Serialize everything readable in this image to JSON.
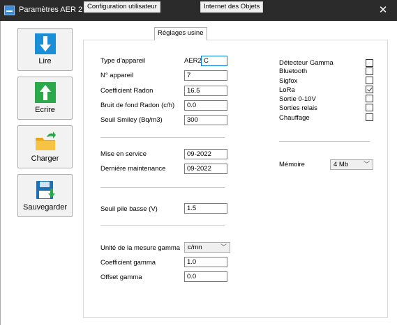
{
  "window": {
    "title": "Paramètres AER 2",
    "close_glyph": "✕"
  },
  "sidebar": {
    "buttons": [
      {
        "label": "Lire",
        "icon": "arrow-down-icon"
      },
      {
        "label": "Ecrire",
        "icon": "arrow-up-icon"
      },
      {
        "label": "Charger",
        "icon": "folder-icon"
      },
      {
        "label": "Sauvegarder",
        "icon": "floppy-icon"
      }
    ]
  },
  "tabs": [
    {
      "label": "Configuration utilisateur",
      "active": false
    },
    {
      "label": "Réglages usine",
      "active": true
    },
    {
      "label": "Internet des Objets",
      "active": false
    }
  ],
  "form": {
    "device_type": {
      "label": "Type d'appareil",
      "prefix": "AER2",
      "value": "C"
    },
    "device_number": {
      "label": "N° appareil",
      "value": "7"
    },
    "radon_coef": {
      "label": "Coefficient Radon",
      "value": "16.5"
    },
    "radon_background": {
      "label": "Bruit de fond Radon (c/h)",
      "value": "0.0"
    },
    "smiley_threshold": {
      "label": "Seuil Smiley (Bq/m3)",
      "value": "300"
    },
    "commissioning": {
      "label": "Mise en service",
      "value": "09-2022"
    },
    "last_maintenance": {
      "label": "Dernière maintenance",
      "value": "09-2022"
    },
    "low_battery": {
      "label": "Seuil pile basse (V)",
      "value": "1.5"
    },
    "gamma_unit": {
      "label": "Unité de la mesure gamma",
      "value": "c/mn"
    },
    "gamma_coef": {
      "label": "Coefficient gamma",
      "value": "1.0"
    },
    "gamma_offset": {
      "label": "Offset gamma",
      "value": "0.0"
    }
  },
  "options": [
    {
      "label": "Détecteur Gamma",
      "checked": false
    },
    {
      "label": "Bluetooth",
      "checked": false
    },
    {
      "label": "Sigfox",
      "checked": false
    },
    {
      "label": "LoRa",
      "checked": true
    },
    {
      "label": "Sortie 0-10V",
      "checked": false
    },
    {
      "label": "Sorties relais",
      "checked": false
    },
    {
      "label": "Chauffage",
      "checked": false
    }
  ],
  "memory": {
    "label": "Mémoire",
    "value": "4 Mb"
  }
}
